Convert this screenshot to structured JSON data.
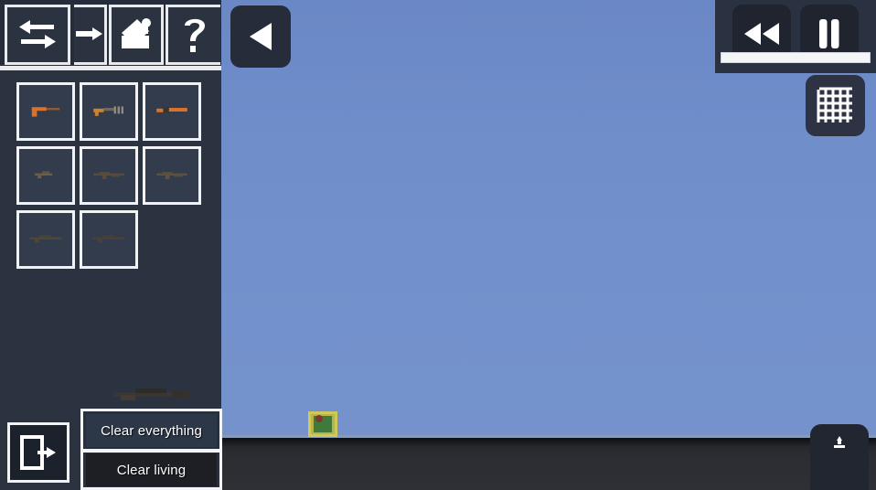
{
  "app": {
    "title": "Sandbox Weapon Simulator",
    "colors": {
      "sky": "#6f8dc8",
      "ground": "#2b2d33",
      "sidebar": "#2b3341",
      "panel_border": "#f0f2f5",
      "accent_orange": "#d9722a",
      "object_yellow": "#b9b44a",
      "object_green": "#3f7a3a"
    }
  },
  "sidebar": {
    "toolbar": {
      "buttons": [
        {
          "name": "swap-tool",
          "icon": "swap-arrows-icon",
          "label": "Swap"
        },
        {
          "name": "export-tool",
          "icon": "arrow-into-bracket-icon",
          "label": "Export"
        },
        {
          "name": "paint-tool",
          "icon": "paint-bucket-icon",
          "label": "Paint"
        },
        {
          "name": "help-tool",
          "icon": "question-mark-icon",
          "label": "Help"
        }
      ]
    },
    "weapons": {
      "label": "Weapon inventory",
      "slots": [
        {
          "name": "pistol",
          "label": "Pistol",
          "color": "#d9722a",
          "style": "pistol"
        },
        {
          "name": "submachine-gun",
          "label": "Submachine Gun",
          "color": "#c9822f",
          "style": "smg"
        },
        {
          "name": "shotgun",
          "label": "Shotgun",
          "color": "#d9722a",
          "style": "shotgun"
        },
        {
          "name": "carbine",
          "label": "Carbine",
          "color": "#6b5d46",
          "style": "carbine"
        },
        {
          "name": "assault-rifle",
          "label": "Assault Rifle",
          "color": "#574c3c",
          "style": "rifle"
        },
        {
          "name": "battle-rifle",
          "label": "Battle Rifle",
          "color": "#5d5140",
          "style": "rifle"
        },
        {
          "name": "sniper-rifle",
          "label": "Sniper Rifle",
          "color": "#4f4638",
          "style": "sniper"
        },
        {
          "name": "marksman-rifle",
          "label": "Marksman Rifle",
          "color": "#4a4134",
          "style": "sniper"
        }
      ]
    },
    "loose_weapon": {
      "name": "rocket-launcher",
      "label": "Rocket Launcher",
      "color": "#3a3630"
    },
    "exit_button": {
      "name": "exit",
      "icon": "exit-door-icon",
      "label": "Exit"
    },
    "clear_panel": {
      "clear_everything_label": "Clear everything",
      "clear_living_label": "Clear living"
    }
  },
  "game_controls": {
    "back_button": {
      "icon": "play-left-triangle-icon",
      "label": "Back"
    },
    "rewind_button": {
      "icon": "rewind-double-arrow-icon",
      "label": "Rewind"
    },
    "pause_button": {
      "icon": "pause-icon",
      "label": "Pause"
    },
    "grid_button": {
      "icon": "grid-icon",
      "label": "Toggle grid"
    },
    "speed_bar": {
      "name": "speed-slider",
      "value": 100
    },
    "download_button": {
      "icon": "download-icon",
      "label": "Download"
    }
  },
  "world": {
    "object": {
      "name": "spawned-entity",
      "label": "Spawned entity"
    }
  }
}
